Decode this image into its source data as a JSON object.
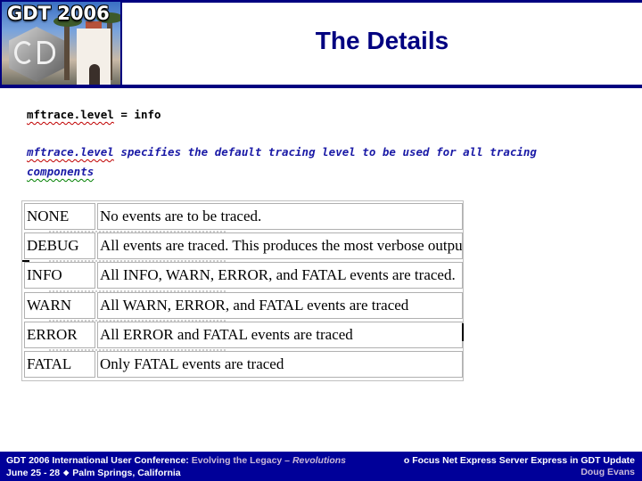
{
  "header": {
    "logo_text": "GDT 2006",
    "title": "The Details"
  },
  "code": {
    "setting_key": "mftrace.level",
    "setting_rest": " = info",
    "desc_key": "mftrace.level",
    "desc_rest": " specifies the default tracing level to be used for all tracing",
    "desc_line2": "components"
  },
  "levels": [
    {
      "name": "NONE",
      "description": "No events are to be traced."
    },
    {
      "name": "DEBUG",
      "description": "All events are traced. This produces the most verbose output."
    },
    {
      "name": "INFO",
      "description": "All INFO, WARN, ERROR, and FATAL events are traced."
    },
    {
      "name": "WARN",
      "description": "All WARN, ERROR, and FATAL events are traced"
    },
    {
      "name": "ERROR",
      "description": "All ERROR and FATAL events are traced"
    },
    {
      "name": "FATAL",
      "description": "Only FATAL events are traced"
    }
  ],
  "footer": {
    "conference": "GDT 2006 International User Conference: ",
    "theme": "Evolving the Legacy – ",
    "theme_italic": "Revolutions",
    "dates": "June 25 - 28",
    "separator_icon": "diamond-bullet",
    "location": "Palm Springs, California",
    "session_title": "o Focus Net Express Server Express in GDT Update",
    "author": "Doug Evans"
  },
  "colors": {
    "brand_navy": "#000080",
    "footer_bg": "#000099",
    "accent_lavender": "#c8b8d8"
  }
}
